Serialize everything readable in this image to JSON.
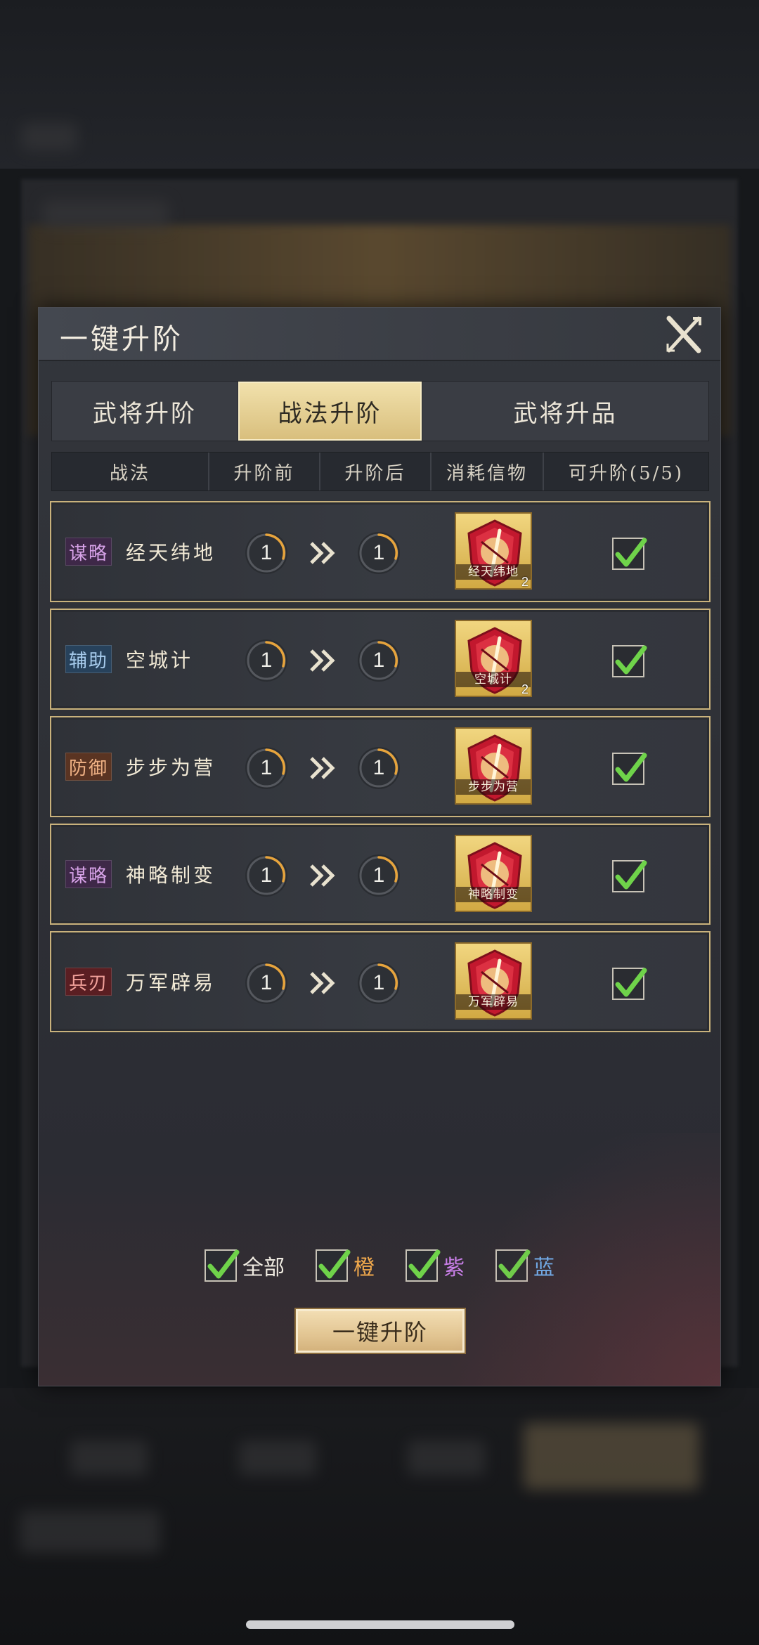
{
  "dialog": {
    "title": "一键升阶"
  },
  "tabs": [
    {
      "label": "武将升阶",
      "active": false
    },
    {
      "label": "战法升阶",
      "active": true
    },
    {
      "label": "武将升品",
      "active": false
    }
  ],
  "table": {
    "headers": [
      "战法",
      "升阶前",
      "升阶后",
      "消耗信物",
      "可升阶(5/5)"
    ],
    "rows": [
      {
        "type": "谋略",
        "type_color": "purple",
        "name": "经天纬地",
        "before": "1",
        "after": "1",
        "item_label": "经天纬地",
        "item_count": "2",
        "checked": true
      },
      {
        "type": "辅助",
        "type_color": "blue",
        "name": "空城计",
        "before": "1",
        "after": "1",
        "item_label": "空城计",
        "item_count": "2",
        "checked": true
      },
      {
        "type": "防御",
        "type_color": "orange",
        "name": "步步为营",
        "before": "1",
        "after": "1",
        "item_label": "步步为营",
        "item_count": "",
        "checked": true
      },
      {
        "type": "谋略",
        "type_color": "purple",
        "name": "神略制变",
        "before": "1",
        "after": "1",
        "item_label": "神略制变",
        "item_count": "",
        "checked": true
      },
      {
        "type": "兵刃",
        "type_color": "red",
        "name": "万军辟易",
        "before": "1",
        "after": "1",
        "item_label": "万军辟易",
        "item_count": "",
        "checked": true
      }
    ]
  },
  "filters": [
    {
      "label": "全部",
      "color": "#f0ece2",
      "checked": true
    },
    {
      "label": "橙",
      "color": "#f1a94c",
      "checked": true
    },
    {
      "label": "紫",
      "color": "#c77ee6",
      "checked": true
    },
    {
      "label": "蓝",
      "color": "#6fb1f0",
      "checked": true
    }
  ],
  "action_button": "一键升阶",
  "icons": {
    "close": "close-x-icon",
    "check": "checkmark-icon",
    "arrow": "double-chevron-right-icon",
    "token": "shield-token-icon"
  }
}
